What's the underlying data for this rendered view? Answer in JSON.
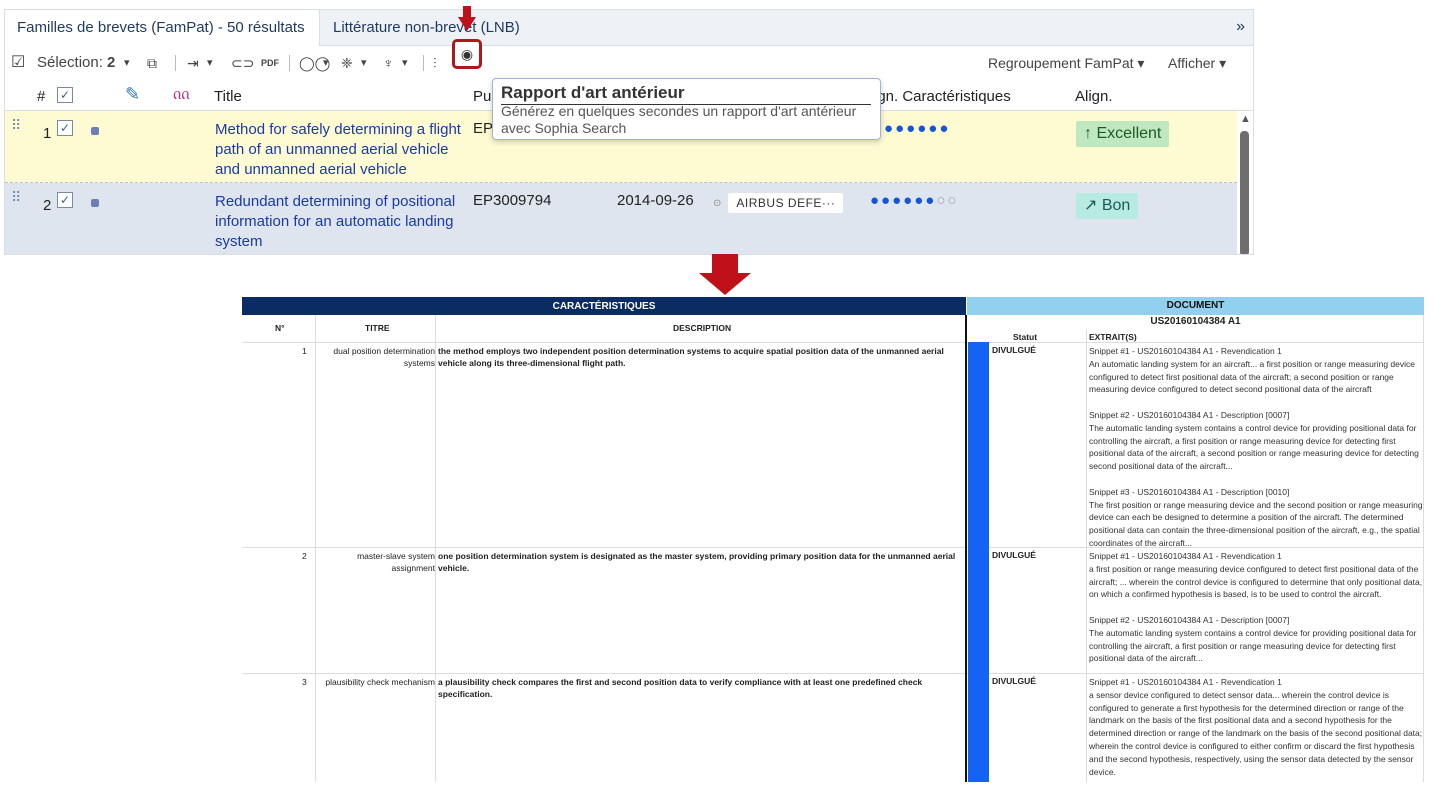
{
  "tabs": {
    "fampat": "Familles de brevets (FamPat) - 50 résultats",
    "lnb": "Littérature non-brevet (LNB)",
    "more": "»"
  },
  "toolbar": {
    "selection_label": "Sélection:",
    "selection_count": "2",
    "regroupement": "Regroupement FamPat ▾",
    "afficher": "Afficher ▾"
  },
  "table_headers": {
    "num": "#",
    "title": "Title",
    "pub": "Pu",
    "align_car": "ign. Caractéristiques",
    "align": "Align."
  },
  "rows": [
    {
      "num": "1",
      "title": "Method for safely determining a flight path of an unmanned aerial vehicle and unmanned aerial vehicle",
      "pub": "EP",
      "date": "",
      "assignee": "",
      "score_filled": 7,
      "score_total": 7,
      "dots": "●●●●●●●",
      "dots_empty": "",
      "align": "↑ Excellent"
    },
    {
      "num": "2",
      "title": "Redundant determining of positional information for an automatic landing system",
      "pub": "EP3009794",
      "date": "2014-09-26",
      "assignee": "AIRBUS DEFE···",
      "score_filled": 6,
      "score_total": 8,
      "dots": "●●●●●●",
      "dots_empty": "○○",
      "align": "↗ Bon"
    }
  ],
  "tooltip": {
    "title": "Rapport d'art antérieur",
    "desc": "Générez en quelques secondes un rapport d'art antérieur avec Sophia Search"
  },
  "colors": {
    "highlight": "#b0171d",
    "arrow": "#c0101a",
    "report_header": "#0a2c62",
    "doc_header": "#92d0f0",
    "status_bar": "#1463f5"
  },
  "report": {
    "left_header": "CARACTÉRISTIQUES",
    "right_header": "DOCUMENT",
    "doc_id": "US20160104384 A1",
    "col_num": "N°",
    "col_titre": "TITRE",
    "col_desc": "DESCRIPTION",
    "col_statut": "Statut",
    "col_extraits": "EXTRAIT(S)",
    "rows": [
      {
        "n": "1",
        "titre": "dual position determination systems",
        "desc": "the method employs two independent position determination systems to acquire spatial position data of the unmanned aerial vehicle along its three-dimensional flight path.",
        "statut": "DIVULGUÉ",
        "s1": "Snippet #1 - US20160104384 A1 - Revendication 1",
        "t1": "An automatic landing system for an aircraft... a first position or range measuring device configured to detect first positional data of the aircraft; a second position or range measuring device configured to detect second positional data of the aircraft",
        "s2": "Snippet #2 - US20160104384 A1 - Description [0007]",
        "t2": "The automatic landing system contains a control device for providing positional data for controlling the aircraft, a first position or range measuring device for detecting first positional data of the aircraft, a second position or range measuring device for detecting second positional data of the aircraft...",
        "s3": "Snippet #3 - US20160104384 A1 - Description [0010]",
        "t3": "The first position or range measuring device and the second position or range measuring device can each be designed to determine a position of the aircraft. The determined positional data can contain the three-dimensional position of the aircraft, e.g., the spatial coordinates of the aircraft..."
      },
      {
        "n": "2",
        "titre": "master-slave system assignment",
        "desc": "one position determination system is designated as the master system, providing primary position data for the unmanned aerial vehicle.",
        "statut": "DIVULGUÉ",
        "s1": "Snippet #1 - US20160104384 A1 - Revendication 1",
        "t1": "a first position or range measuring device configured to detect first positional data of the aircraft; ... wherein the control device is configured to determine that only positional data, on which a confirmed hypothesis is based, is to be used to control the aircraft.",
        "s2": "Snippet #2 - US20160104384 A1 - Description [0007]",
        "t2": "The automatic landing system contains a control device for providing positional data for controlling the aircraft, a first position or range measuring device for detecting first positional data of the aircraft..."
      },
      {
        "n": "3",
        "titre": "plausibility check mechanism",
        "desc": "a plausibility check compares the first and second position data to verify compliance with at least one predefined check specification.",
        "statut": "DIVULGUÉ",
        "s1": "Snippet #1 - US20160104384 A1 - Revendication 1",
        "t1": "a sensor device configured to detect sensor data... wherein the control device is configured to generate a first hypothesis for the determined direction or range of the landmark on the basis of the first positional data and a second hypothesis for the determined direction or range of the landmark on the basis of the second positional data; wherein the control device is configured to either confirm or discard the first hypothesis and the second hypothesis, respectively, using the sensor data detected by the sensor device."
      }
    ]
  }
}
